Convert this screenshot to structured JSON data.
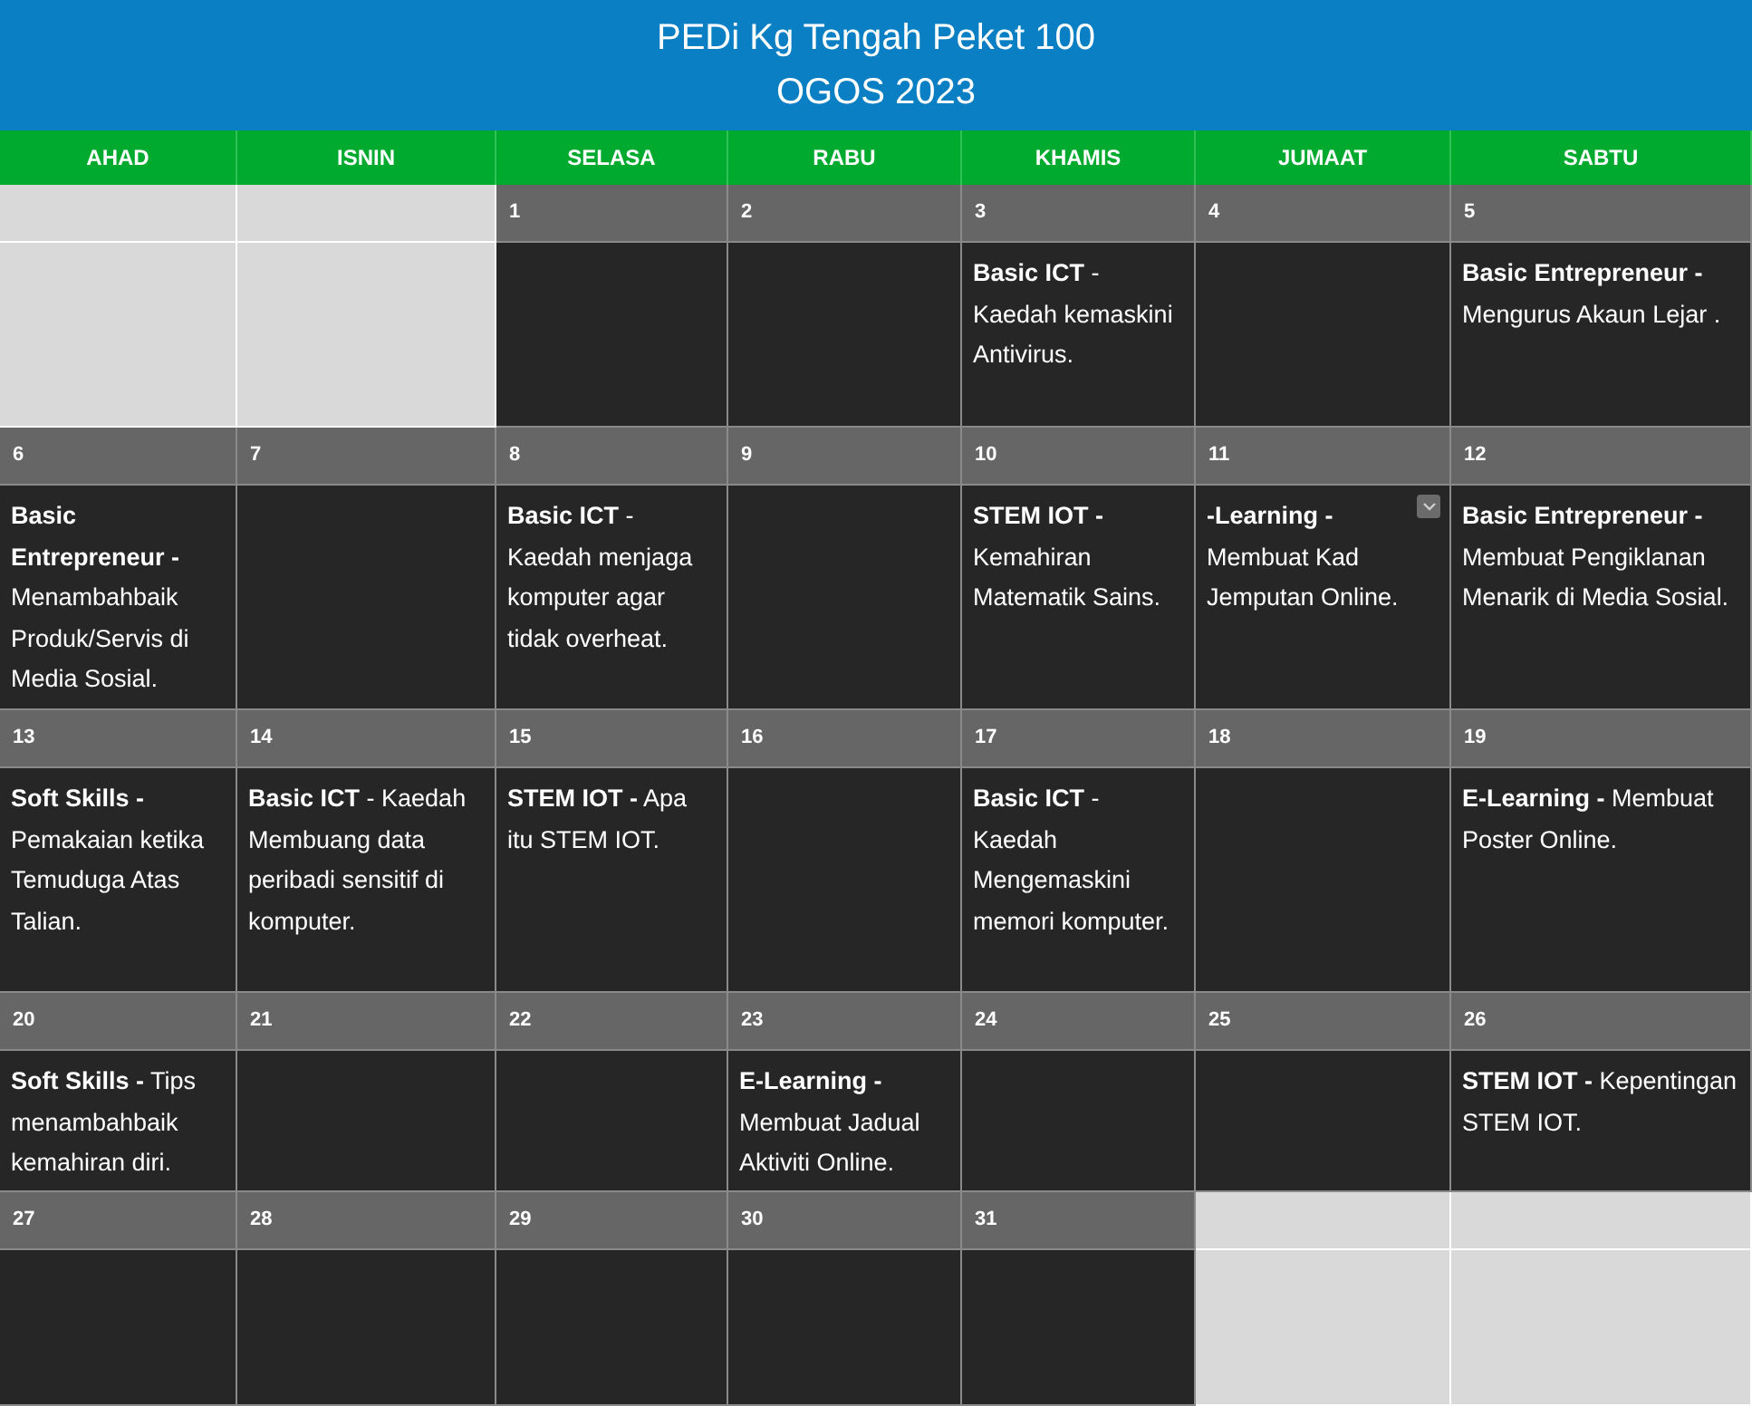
{
  "header": {
    "title": "PEDi Kg Tengah Peket 100",
    "subtitle": "OGOS 2023"
  },
  "weekdays": [
    "AHAD",
    "ISNIN",
    "SELASA",
    "RABU",
    "KHAMIS",
    "JUMAAT",
    "SABTU"
  ],
  "weeks": [
    [
      {
        "kind": "blank"
      },
      {
        "kind": "blank"
      },
      {
        "kind": "day",
        "date": "1"
      },
      {
        "kind": "day",
        "date": "2"
      },
      {
        "kind": "day",
        "date": "3",
        "event": "**Basic ICT** - Kaedah kemaskini Antivirus."
      },
      {
        "kind": "day",
        "date": "4"
      },
      {
        "kind": "day",
        "date": "5",
        "event": "**Basic Entrepreneur -** Mengurus Akaun Lejar ."
      }
    ],
    [
      {
        "kind": "day",
        "date": "6",
        "event": "**Basic Entrepreneur -** Menambahbaik Produk/Servis di Media Sosial."
      },
      {
        "kind": "day",
        "date": "7"
      },
      {
        "kind": "day",
        "date": "8",
        "event": "**Basic ICT** - Kaedah menjaga komputer agar tidak overheat."
      },
      {
        "kind": "day",
        "date": "9"
      },
      {
        "kind": "day",
        "date": "10",
        "event": "**STEM IOT -** Kemahiran Matematik Sains."
      },
      {
        "kind": "day",
        "date": "11",
        "event": "**-Learning -** Membuat Kad Jemputan Online.",
        "dropdown": true
      },
      {
        "kind": "day",
        "date": "12",
        "event": "**Basic Entrepreneur -** Membuat Pengiklanan Menarik di Media Sosial."
      }
    ],
    [
      {
        "kind": "day",
        "date": "13",
        "event": "**Soft Skills -** Pemakaian ketika Temuduga Atas Talian."
      },
      {
        "kind": "day",
        "date": "14",
        "event": "**Basic ICT** -  Kaedah Membuang data peribadi sensitif di komputer."
      },
      {
        "kind": "day",
        "date": "15",
        "event": "**STEM IOT -** Apa itu STEM IOT."
      },
      {
        "kind": "day",
        "date": "16"
      },
      {
        "kind": "day",
        "date": "17",
        "event": "**Basic ICT** - Kaedah Mengemaskini memori komputer."
      },
      {
        "kind": "day",
        "date": "18"
      },
      {
        "kind": "day",
        "date": "19",
        "event": "**E-Learning -** Membuat Poster Online."
      }
    ],
    [
      {
        "kind": "day",
        "date": "20",
        "event": "**Soft Skills -** Tips menambahbaik kemahiran diri."
      },
      {
        "kind": "day",
        "date": "21"
      },
      {
        "kind": "day",
        "date": "22"
      },
      {
        "kind": "day",
        "date": "23",
        "event": "**E-Learning -** Membuat Jadual Aktiviti Online."
      },
      {
        "kind": "day",
        "date": "24"
      },
      {
        "kind": "day",
        "date": "25"
      },
      {
        "kind": "day",
        "date": "26",
        "event": "**STEM IOT -** Kepentingan STEM IOT."
      }
    ],
    [
      {
        "kind": "day",
        "date": "27"
      },
      {
        "kind": "day",
        "date": "28"
      },
      {
        "kind": "day",
        "date": "29"
      },
      {
        "kind": "day",
        "date": "30"
      },
      {
        "kind": "day",
        "date": "31"
      },
      {
        "kind": "blank"
      },
      {
        "kind": "blank"
      }
    ]
  ]
}
